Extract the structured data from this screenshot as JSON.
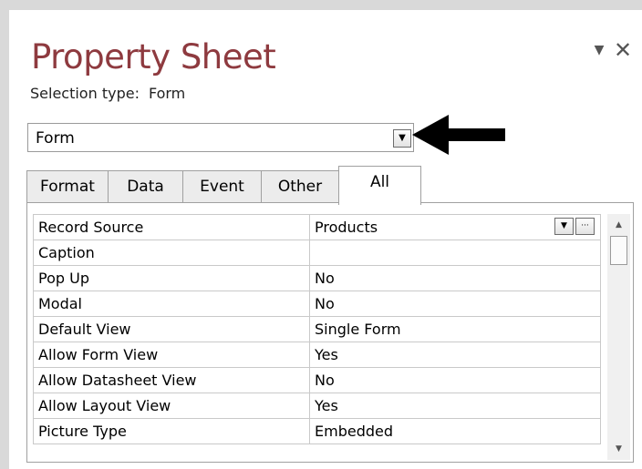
{
  "panel": {
    "title": "Property Sheet",
    "arrow_glyph": "▼",
    "close_glyph": "✕"
  },
  "selection": {
    "label": "Selection type:",
    "value": "Form"
  },
  "object_combo": {
    "value": "Form",
    "arrow_glyph": "▼"
  },
  "tabs": [
    {
      "label": "Format",
      "active": false
    },
    {
      "label": "Data",
      "active": false
    },
    {
      "label": "Event",
      "active": false
    },
    {
      "label": "Other",
      "active": false
    },
    {
      "label": "All",
      "active": true
    }
  ],
  "properties": [
    {
      "name": "Record Source",
      "value": "Products",
      "selected": true
    },
    {
      "name": "Caption",
      "value": ""
    },
    {
      "name": "Pop Up",
      "value": "No"
    },
    {
      "name": "Modal",
      "value": "No"
    },
    {
      "name": "Default View",
      "value": "Single Form"
    },
    {
      "name": "Allow Form View",
      "value": "Yes"
    },
    {
      "name": "Allow Datasheet View",
      "value": "No"
    },
    {
      "name": "Allow Layout View",
      "value": "Yes"
    },
    {
      "name": "Picture Type",
      "value": "Embedded"
    }
  ],
  "record_source_buttons": {
    "dropdown_glyph": "▼",
    "builder_glyph": "···"
  },
  "scrollbar": {
    "up_glyph": "▲",
    "down_glyph": "▼"
  },
  "icons": {
    "callout": "arrow-left-icon",
    "callout_color": "#000000"
  },
  "colors": {
    "title": "#8e3a3f",
    "frame": "#d9d9d9"
  }
}
